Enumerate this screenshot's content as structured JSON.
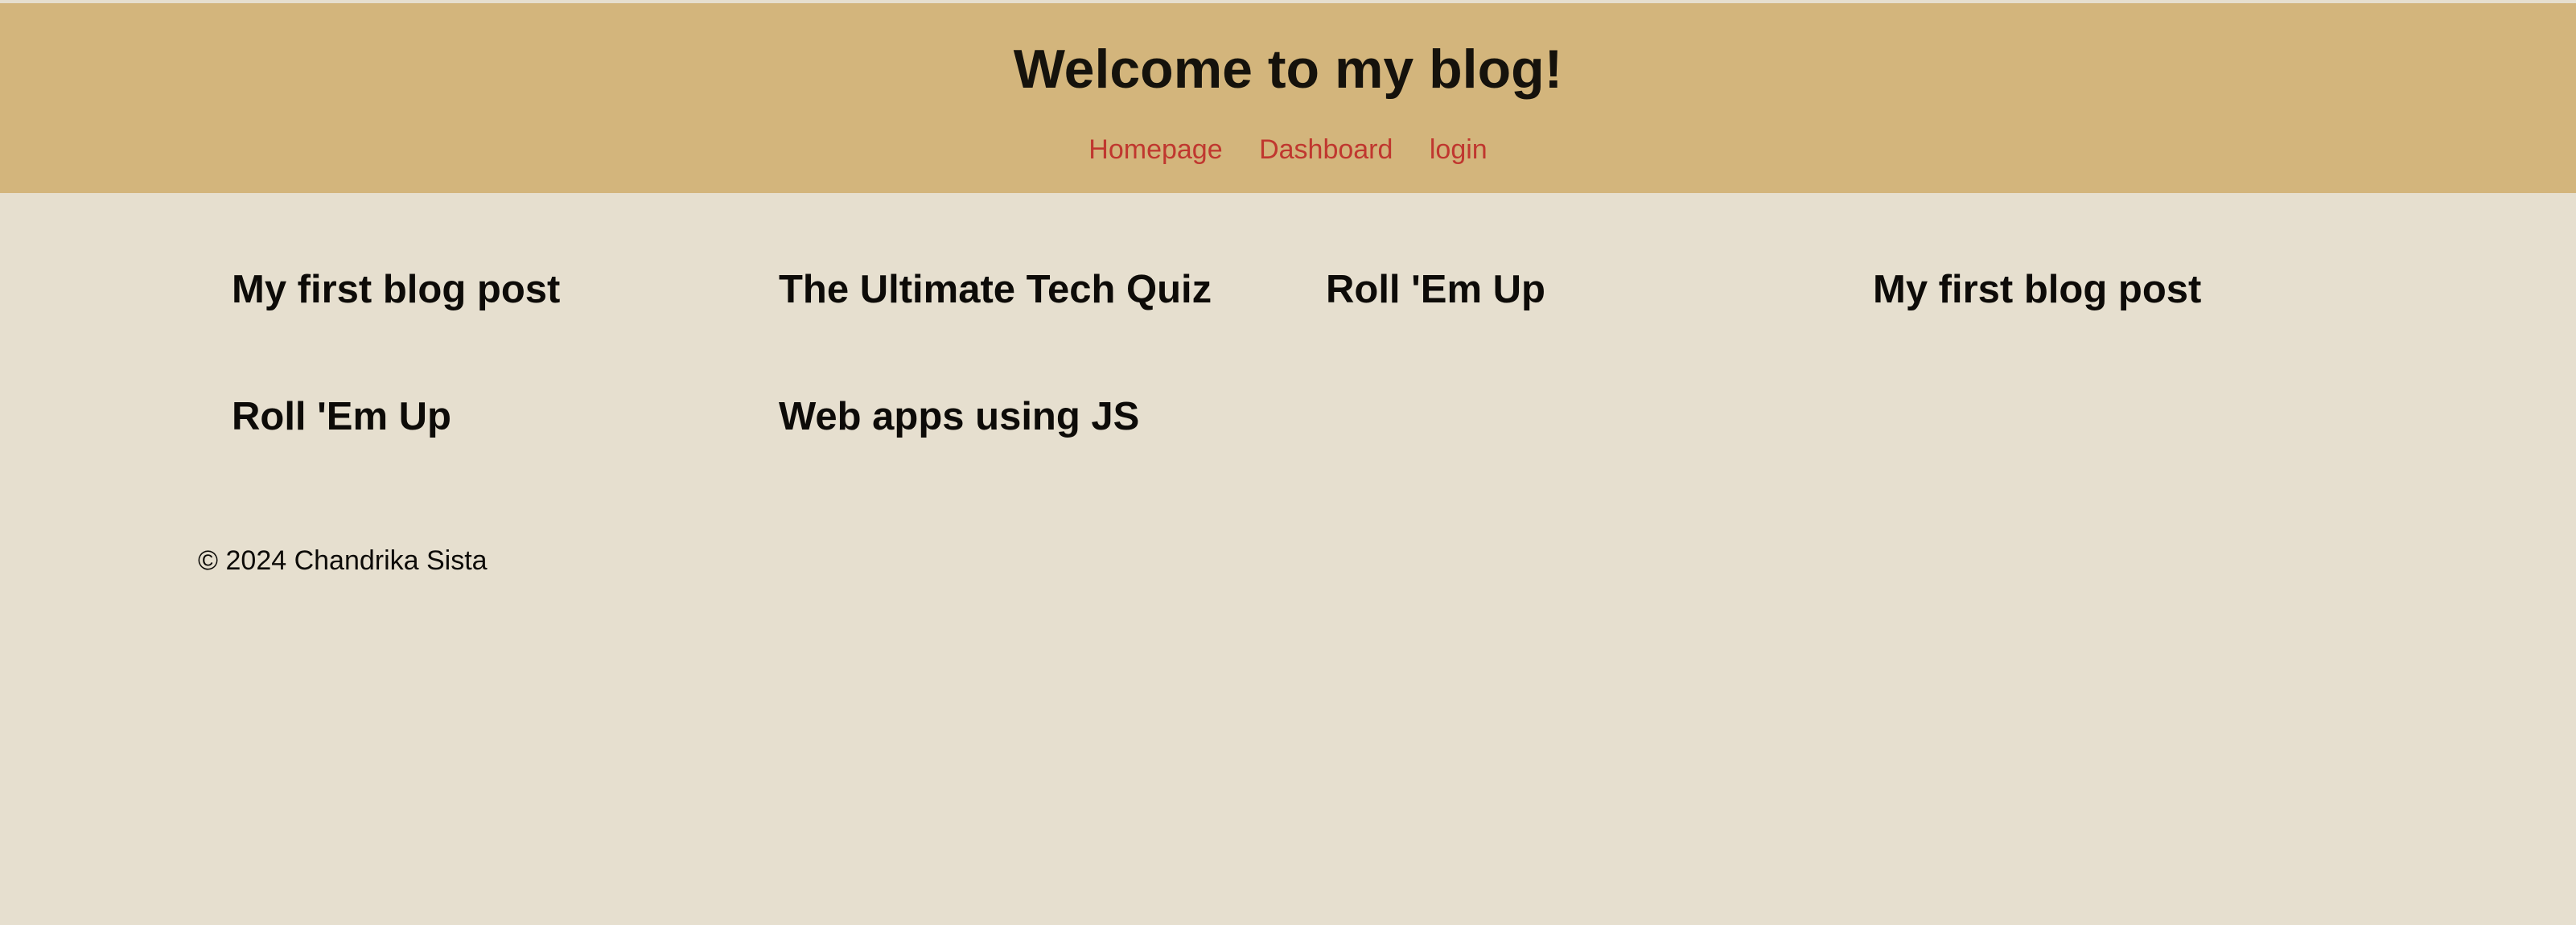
{
  "header": {
    "title": "Welcome to my blog!",
    "nav": [
      {
        "label": "Homepage"
      },
      {
        "label": "Dashboard"
      },
      {
        "label": "login"
      }
    ]
  },
  "posts": [
    {
      "title": "My first blog post"
    },
    {
      "title": "The Ultimate Tech Quiz"
    },
    {
      "title": "Roll 'Em Up"
    },
    {
      "title": "My first blog post"
    },
    {
      "title": "Roll 'Em Up"
    },
    {
      "title": "Web apps using JS"
    }
  ],
  "footer": {
    "copyright": "© 2024 Chandrika Sista"
  },
  "colors": {
    "header_bg": "#d3b57c",
    "page_bg": "#e6dfcf",
    "nav_link": "#c0372f",
    "text": "#0d0b08"
  }
}
